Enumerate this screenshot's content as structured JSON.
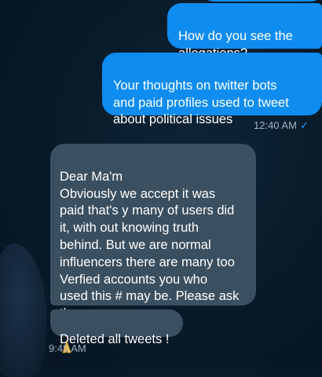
{
  "messages": [
    {
      "id": "out1",
      "direction": "outgoing",
      "text": "How do you see the\nallegations?"
    },
    {
      "id": "out2",
      "direction": "outgoing",
      "text": "Your thoughts on twitter bots\nand paid profiles used to tweet\nabout political issues"
    },
    {
      "id": "in1",
      "direction": "incoming",
      "text": "Dear Ma'm\nObviously we accept it was\npaid that's y many of users did\nit, with out knowing truth\nbehind. But we are normal\ninfluencers there are many too\nVerfied accounts you who\nused this # may be. Please ask\nthem",
      "emoji": "folded-hands-icon"
    },
    {
      "id": "in2",
      "direction": "incoming",
      "text": "Deleted all tweets !"
    }
  ],
  "timestamps": {
    "outgoing": "12:40 AM",
    "outgoing_tick": "✓",
    "incoming": "9:45 AM"
  },
  "colors": {
    "outgoing_bubble": "#0f8cf0",
    "incoming_bubble": "#3a4f5f",
    "background": "#081a29",
    "tick": "#1f9bff"
  }
}
